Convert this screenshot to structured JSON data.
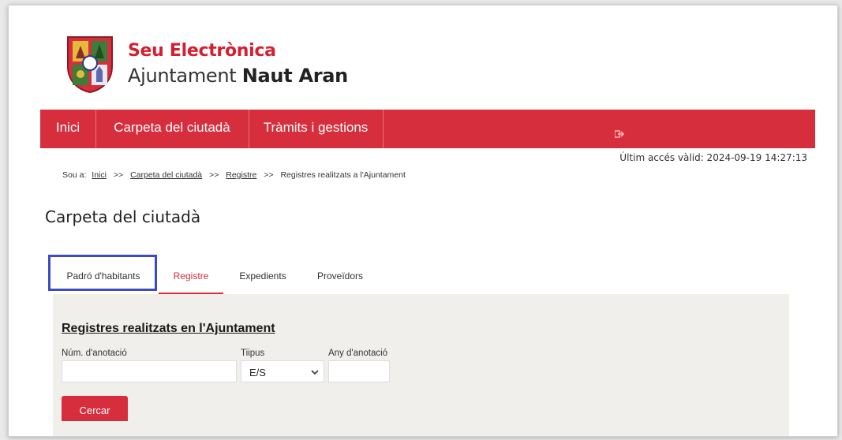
{
  "brand": {
    "title": "Seu Electrònica",
    "subtitle_prefix": "Ajuntament",
    "subtitle_bold": "Naut Aran"
  },
  "nav": {
    "items": [
      {
        "label": "Inici"
      },
      {
        "label": "Carpeta del ciutadà"
      },
      {
        "label": "Tràmits i gestions"
      }
    ],
    "logout_icon": "logout-icon",
    "color": "#d62e3c"
  },
  "last_access": "Últim accés vàlid: 2024-09-19 14:27:13",
  "breadcrumb": {
    "prefix": "Sou a:",
    "items": [
      "Inici",
      "Carpeta del ciutadà",
      "Registre"
    ],
    "separator": ">>",
    "current": "Registres realitzats a l'Ajuntament"
  },
  "page_title": "Carpeta del ciutadà",
  "tabs": [
    {
      "label": "Padró d'habitants"
    },
    {
      "label": "Registre",
      "active": true
    },
    {
      "label": "Expedients"
    },
    {
      "label": "Proveïdors"
    }
  ],
  "highlight_color": "#3b4bc4",
  "form": {
    "title": "Registres realitzats en l'Ajuntament",
    "num_label": "Núm. d'anotació",
    "num_value": "",
    "tipus_label": "Tiipus",
    "tipus_value": "E/S",
    "any_label": "Any d'anotació",
    "any_value": "",
    "search_button": "Cercar"
  }
}
